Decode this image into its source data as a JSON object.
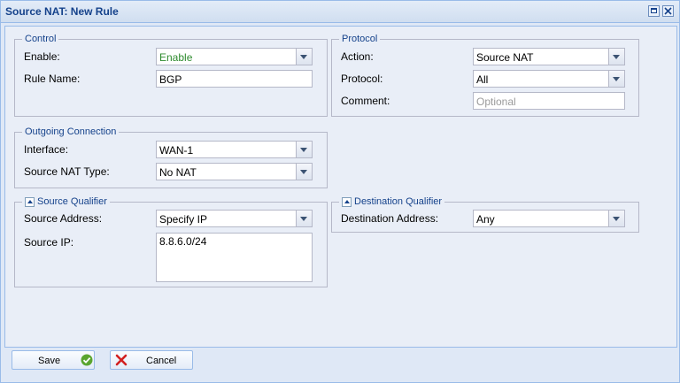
{
  "window": {
    "title": "Source NAT: New Rule"
  },
  "control": {
    "legend": "Control",
    "enable_label": "Enable:",
    "enable_value": "Enable",
    "rule_name_label": "Rule Name:",
    "rule_name_value": "BGP"
  },
  "protocol": {
    "legend": "Protocol",
    "action_label": "Action:",
    "action_value": "Source NAT",
    "protocol_label": "Protocol:",
    "protocol_value": "All",
    "comment_label": "Comment:",
    "comment_placeholder": "Optional"
  },
  "outgoing": {
    "legend": "Outgoing Connection",
    "interface_label": "Interface:",
    "interface_value": "WAN-1",
    "nat_type_label": "Source NAT Type:",
    "nat_type_value": "No NAT"
  },
  "source_qualifier": {
    "legend": "Source Qualifier",
    "address_label": "Source Address:",
    "address_value": "Specify IP",
    "ip_label": "Source IP:",
    "ip_value": "8.8.6.0/24"
  },
  "destination_qualifier": {
    "legend": "Destination Qualifier",
    "address_label": "Destination Address:",
    "address_value": "Any"
  },
  "footer": {
    "save_label": "Save",
    "cancel_label": "Cancel"
  },
  "colors": {
    "title_text": "#15428b",
    "border": "#99bbe8",
    "enable_green": "#2e8b2e",
    "save_icon": "#5aa52f",
    "cancel_icon": "#d22020"
  },
  "icons": [
    "maximize-icon",
    "close-icon",
    "collapse-icon",
    "check-icon",
    "cross-icon",
    "chevron-down-icon"
  ]
}
